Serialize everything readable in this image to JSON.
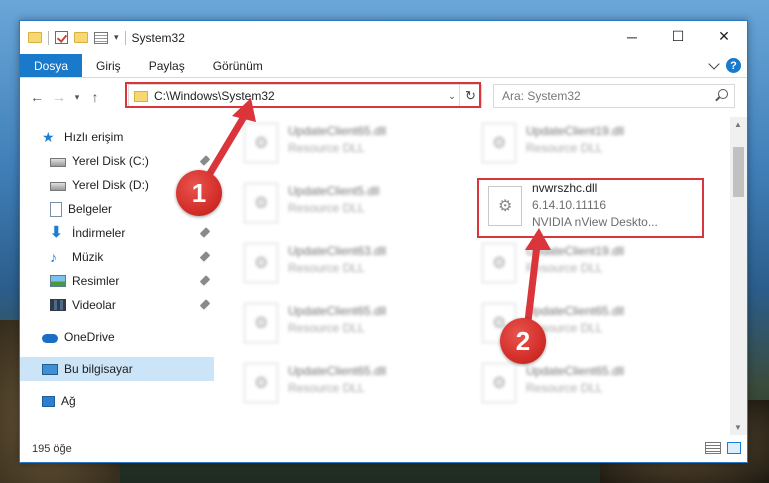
{
  "window": {
    "title": "System32"
  },
  "ribbon": {
    "tabs": [
      "Dosya",
      "Giriş",
      "Paylaş",
      "Görünüm"
    ]
  },
  "nav": {
    "address": "C:\\Windows\\System32",
    "search_placeholder": "Ara: System32"
  },
  "sidebar": {
    "quick_access": "Hızlı erişim",
    "items": [
      "Yerel Disk (C:)",
      "Yerel Disk (D:)",
      "Belgeler",
      "İndirmeler",
      "Müzik",
      "Resimler",
      "Videolar"
    ],
    "onedrive": "OneDrive",
    "this_pc": "Bu bilgisayar",
    "network": "Ağ"
  },
  "files": {
    "col1": [
      {
        "name": "UpdateClient65.dll",
        "type": "Resource DLL"
      },
      {
        "name": "UpdateClient5.dll",
        "type": "Resource DLL"
      },
      {
        "name": "UpdateClient63.dll",
        "type": "Resource DLL"
      },
      {
        "name": "UpdateClient65.dll",
        "type": "Resource DLL"
      },
      {
        "name": "UpdateClient65.dll",
        "type": "Resource DLL"
      }
    ],
    "col2": [
      {
        "name": "UpdateClient19.dll",
        "type": "Resource DLL"
      },
      {
        "name": "UpdateClient19.dll",
        "type": "Resource DLL"
      },
      {
        "name": "UpdateClient65.dll",
        "type": "Resource DLL"
      },
      {
        "name": "UpdateClient65.dll",
        "type": "Resource DLL"
      }
    ],
    "focused": {
      "name": "nvwrszhc.dll",
      "version": "6.14.10.11116",
      "description": "NVIDIA nView Deskto..."
    }
  },
  "status": {
    "count": "195 öğe"
  },
  "annotations": {
    "badge1": "1",
    "badge2": "2",
    "accent": "#d9353a"
  }
}
